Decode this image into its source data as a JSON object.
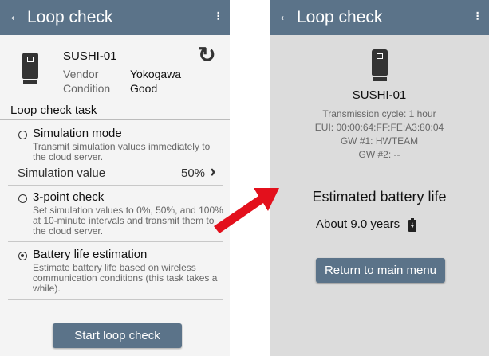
{
  "left": {
    "appbar": {
      "back": "←",
      "title": "Loop check",
      "menu": "⁝"
    },
    "device": {
      "name": "SUSHI-01",
      "vendor_label": "Vendor",
      "vendor_value": "Yokogawa",
      "condition_label": "Condition",
      "condition_value": "Good",
      "refresh": "↻"
    },
    "section_title": "Loop check task",
    "options": [
      {
        "title": "Simulation mode",
        "desc": "Transmit simulation values immediately to the cloud server.",
        "selected": false
      },
      {
        "title": "3-point check",
        "desc": "Set simulation values to 0%, 50%, and 100% at 10-minute intervals and transmit them to the cloud server.",
        "selected": false
      },
      {
        "title": "Battery life estimation",
        "desc": "Estimate battery life based on wireless communication conditions (this task takes a while).",
        "selected": true
      }
    ],
    "simulation_value": {
      "label": "Simulation value",
      "value": "50%",
      "chevron": "›"
    },
    "start_button": "Start loop check"
  },
  "right": {
    "appbar": {
      "back": "←",
      "title": "Loop check",
      "menu": "⁝"
    },
    "device_name": "SUSHI-01",
    "info": [
      "Transmission cycle: 1 hour",
      "EUI: 00:00:64:FF:FE:A3:80:04",
      "GW #1: HWTEAM",
      "GW #2: --"
    ],
    "battery_title": "Estimated battery life",
    "battery_value": "About 9.0 years",
    "return_button": "Return to main menu"
  },
  "colors": {
    "appbar": "#5b7389",
    "arrow": "#e3101c",
    "right_bg": "#dcdcdc",
    "left_bg": "#f4f4f4"
  },
  "icons": [
    "back-arrow-icon",
    "menu-dots-icon",
    "device-icon",
    "refresh-icon",
    "chevron-right-icon",
    "battery-icon",
    "radio-icon",
    "red-arrow-icon"
  ]
}
